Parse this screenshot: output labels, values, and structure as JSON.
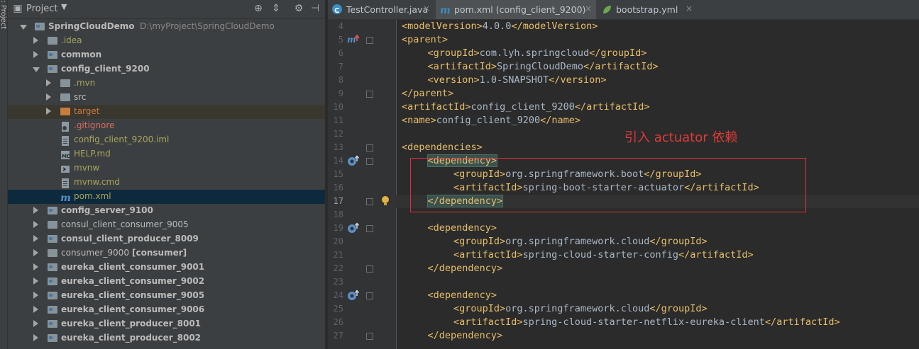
{
  "side_strip": {
    "label": "1: Project"
  },
  "project_panel": {
    "title": "Project",
    "tree": [
      {
        "label": "SpringCloudDemo",
        "path": "D:\\myProject\\SpringCloudDemo",
        "indent": 0,
        "arrow": "expanded",
        "icon": "module-folder",
        "style": "bold"
      },
      {
        "label": ".idea",
        "indent": 1,
        "arrow": "collapsed",
        "icon": "folder",
        "style": "yellow"
      },
      {
        "label": "common",
        "indent": 1,
        "arrow": "collapsed",
        "icon": "module-folder",
        "style": "bold"
      },
      {
        "label": "config_client_9200",
        "indent": 1,
        "arrow": "expanded",
        "icon": "module-folder",
        "style": "bold"
      },
      {
        "label": ".mvn",
        "indent": 2,
        "arrow": "collapsed",
        "icon": "folder",
        "style": "yellow"
      },
      {
        "label": "src",
        "indent": 2,
        "arrow": "collapsed",
        "icon": "folder",
        "style": "normal"
      },
      {
        "label": "target",
        "indent": 2,
        "arrow": "collapsed",
        "icon": "orange-folder",
        "style": "orange",
        "highlight": "target"
      },
      {
        "label": ".gitignore",
        "indent": 2,
        "arrow": "none",
        "icon": "gitignore-file",
        "style": "red"
      },
      {
        "label": "config_client_9200.iml",
        "indent": 2,
        "arrow": "none",
        "icon": "iml-file",
        "style": "yellow"
      },
      {
        "label": "HELP.md",
        "indent": 2,
        "arrow": "none",
        "icon": "md-file",
        "style": "yellow"
      },
      {
        "label": "mvnw",
        "indent": 2,
        "arrow": "none",
        "icon": "script-file",
        "style": "yellow"
      },
      {
        "label": "mvnw.cmd",
        "indent": 2,
        "arrow": "none",
        "icon": "text-file",
        "style": "yellow"
      },
      {
        "label": "pom.xml",
        "indent": 2,
        "arrow": "none",
        "icon": "maven-file",
        "style": "yellow",
        "highlight": "selected"
      },
      {
        "label": "config_server_9100",
        "indent": 1,
        "arrow": "collapsed",
        "icon": "module-folder",
        "style": "bold"
      },
      {
        "label": "consul_client_consumer_9005",
        "indent": 1,
        "arrow": "collapsed",
        "icon": "folder",
        "style": "normal"
      },
      {
        "label": "consul_client_producer_8009",
        "indent": 1,
        "arrow": "collapsed",
        "icon": "module-folder",
        "style": "bold"
      },
      {
        "label": "consumer_9000",
        "suffix": "[consumer]",
        "indent": 1,
        "arrow": "collapsed",
        "icon": "folder",
        "style": "normal"
      },
      {
        "label": "eureka_client_consumer_9001",
        "indent": 1,
        "arrow": "collapsed",
        "icon": "module-folder",
        "style": "bold"
      },
      {
        "label": "eureka_client_consumer_9002",
        "indent": 1,
        "arrow": "collapsed",
        "icon": "module-folder",
        "style": "bold"
      },
      {
        "label": "eureka_client_consumer_9005",
        "indent": 1,
        "arrow": "collapsed",
        "icon": "module-folder",
        "style": "bold"
      },
      {
        "label": "eureka_client_consumer_9006",
        "indent": 1,
        "arrow": "collapsed",
        "icon": "module-folder",
        "style": "bold"
      },
      {
        "label": "eureka_client_producer_8001",
        "indent": 1,
        "arrow": "collapsed",
        "icon": "module-folder",
        "style": "bold"
      },
      {
        "label": "eureka_client_producer_8002",
        "indent": 1,
        "arrow": "collapsed",
        "icon": "module-folder",
        "style": "bold"
      }
    ]
  },
  "editor": {
    "tabs": [
      {
        "label": "TestController.java",
        "icon": "java-class-icon",
        "icon_color": "#3b8ec1",
        "active": false
      },
      {
        "label": "pom.xml (config_client_9200)",
        "icon": "maven-icon",
        "icon_color": "#3b8ec1",
        "active": true
      },
      {
        "label": "bootstrap.yml",
        "icon": "spring-leaf-icon",
        "icon_color": "#6aa84f",
        "active": false
      }
    ],
    "lines": [
      {
        "n": "4",
        "indent": 0,
        "parts": [
          [
            "t",
            "<modelVersion>"
          ],
          [
            "x",
            "4.0.0"
          ],
          [
            "t",
            "</modelVersion>"
          ]
        ]
      },
      {
        "n": "5",
        "indent": 0,
        "parts": [
          [
            "t",
            "<parent>"
          ]
        ],
        "gutter_icon": "maven-override",
        "fold": true
      },
      {
        "n": "6",
        "indent": 1,
        "parts": [
          [
            "t",
            "<groupId>"
          ],
          [
            "x",
            "com.lyh.springcloud"
          ],
          [
            "t",
            "</groupId>"
          ]
        ]
      },
      {
        "n": "7",
        "indent": 1,
        "parts": [
          [
            "t",
            "<artifactId>"
          ],
          [
            "x",
            "SpringCloudDemo"
          ],
          [
            "t",
            "</artifactId>"
          ]
        ]
      },
      {
        "n": "8",
        "indent": 1,
        "parts": [
          [
            "t",
            "<version>"
          ],
          [
            "x",
            "1.0-SNAPSHOT"
          ],
          [
            "t",
            "</version>"
          ]
        ]
      },
      {
        "n": "9",
        "indent": 0,
        "parts": [
          [
            "t",
            "</parent>"
          ]
        ],
        "fold": true
      },
      {
        "n": "10",
        "indent": 0,
        "parts": [
          [
            "t",
            "<artifactId>"
          ],
          [
            "x",
            "config_client_9200"
          ],
          [
            "t",
            "</artifactId>"
          ]
        ]
      },
      {
        "n": "11",
        "indent": 0,
        "parts": [
          [
            "t",
            "<name>"
          ],
          [
            "x",
            "config_client_9200"
          ],
          [
            "t",
            "</name>"
          ]
        ]
      },
      {
        "n": "12",
        "indent": 0,
        "parts": []
      },
      {
        "n": "13",
        "indent": 0,
        "parts": [
          [
            "t",
            "<dependencies>"
          ]
        ],
        "fold": true
      },
      {
        "n": "14",
        "indent": 1,
        "parts": [
          [
            "h",
            "<dependency>"
          ]
        ],
        "gutter_icon": "dependency-override",
        "fold": true
      },
      {
        "n": "15",
        "indent": 2,
        "parts": [
          [
            "t",
            "<groupId>"
          ],
          [
            "x",
            "org.springframework.boot"
          ],
          [
            "t",
            "</groupId>"
          ]
        ]
      },
      {
        "n": "16",
        "indent": 2,
        "parts": [
          [
            "t",
            "<artifactId>"
          ],
          [
            "x",
            "spring-boot-starter-actuator"
          ],
          [
            "t",
            "</artifactId>"
          ]
        ]
      },
      {
        "n": "17",
        "indent": 1,
        "parts": [
          [
            "h",
            "</dependency>"
          ]
        ],
        "gutter_icon": "bulb",
        "fold": true,
        "current": true
      },
      {
        "n": "18",
        "indent": 0,
        "parts": []
      },
      {
        "n": "19",
        "indent": 1,
        "parts": [
          [
            "t",
            "<dependency>"
          ]
        ],
        "gutter_icon": "dependency-override",
        "fold": true
      },
      {
        "n": "20",
        "indent": 2,
        "parts": [
          [
            "t",
            "<groupId>"
          ],
          [
            "x",
            "org.springframework.cloud"
          ],
          [
            "t",
            "</groupId>"
          ]
        ]
      },
      {
        "n": "21",
        "indent": 2,
        "parts": [
          [
            "t",
            "<artifactId>"
          ],
          [
            "x",
            "spring-cloud-starter-config"
          ],
          [
            "t",
            "</artifactId>"
          ]
        ]
      },
      {
        "n": "22",
        "indent": 1,
        "parts": [
          [
            "t",
            "</dependency>"
          ]
        ],
        "fold": true
      },
      {
        "n": "23",
        "indent": 0,
        "parts": []
      },
      {
        "n": "24",
        "indent": 1,
        "parts": [
          [
            "t",
            "<dependency>"
          ]
        ],
        "gutter_icon": "dependency-override",
        "fold": true
      },
      {
        "n": "25",
        "indent": 2,
        "parts": [
          [
            "t",
            "<groupId>"
          ],
          [
            "x",
            "org.springframework.cloud"
          ],
          [
            "t",
            "</groupId>"
          ]
        ]
      },
      {
        "n": "26",
        "indent": 2,
        "parts": [
          [
            "t",
            "<artifactId>"
          ],
          [
            "x",
            "spring-cloud-starter-netflix-eureka-client"
          ],
          [
            "t",
            "</artifactId>"
          ]
        ]
      },
      {
        "n": "27",
        "indent": 1,
        "parts": [
          [
            "t",
            "</dependency>"
          ]
        ],
        "fold": true
      }
    ],
    "annotation": {
      "text": "引入 actuator 依赖",
      "color": "#e0303a"
    }
  },
  "colors": {
    "tag": "#e8bf6a",
    "text": "#a9b7c6",
    "panel_bg": "#3c3f41",
    "editor_bg": "#2b2b2b",
    "selection": "#0d293e"
  }
}
